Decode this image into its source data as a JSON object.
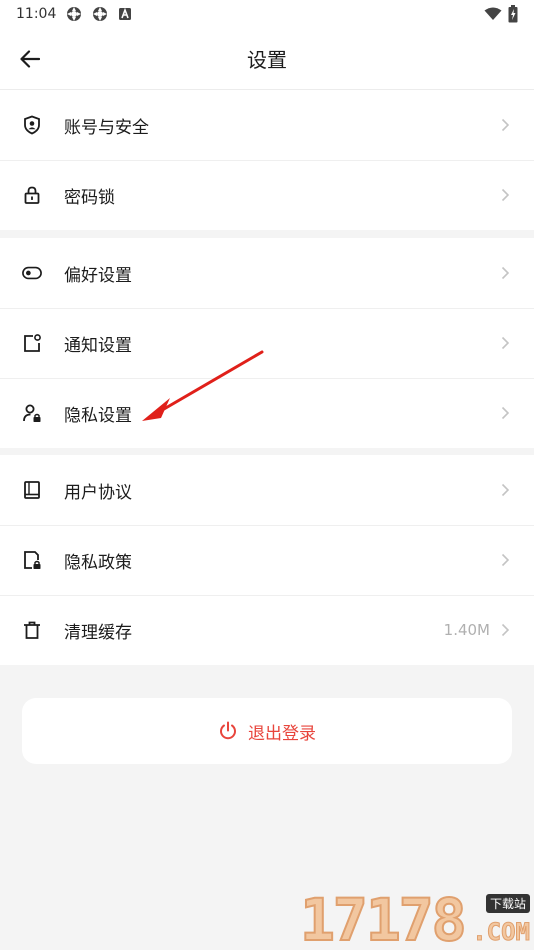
{
  "status_bar": {
    "time": "11:04",
    "icons": [
      "sync-icon",
      "sync-icon",
      "a-badge-icon"
    ],
    "right_icons": [
      "wifi-icon",
      "battery-icon"
    ]
  },
  "header": {
    "title": "设置",
    "back_icon": "arrow-left-icon"
  },
  "groups": [
    {
      "items": [
        {
          "label": "账号与安全",
          "icon": "shield-user-icon"
        },
        {
          "label": "密码锁",
          "icon": "lock-icon"
        }
      ]
    },
    {
      "items": [
        {
          "label": "偏好设置",
          "icon": "toggle-icon"
        },
        {
          "label": "通知设置",
          "icon": "notification-icon"
        },
        {
          "label": "隐私设置",
          "icon": "user-lock-icon"
        }
      ]
    },
    {
      "items": [
        {
          "label": "用户协议",
          "icon": "book-icon"
        },
        {
          "label": "隐私政策",
          "icon": "document-lock-icon"
        },
        {
          "label": "清理缓存",
          "icon": "trash-icon",
          "value": "1.40M"
        }
      ]
    }
  ],
  "logout": {
    "label": "退出登录",
    "icon": "power-icon",
    "color": "#e8453c"
  },
  "annotation": {
    "arrow_color": "#e0201a",
    "points_to": "隐私设置"
  },
  "watermark": {
    "digits": "17178",
    "tag": "下载站",
    "suffix": ".COM"
  }
}
